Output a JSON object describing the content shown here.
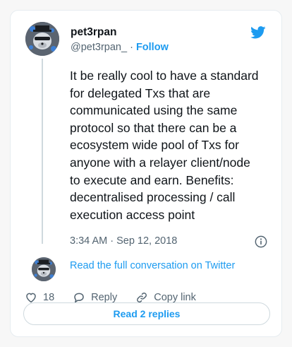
{
  "author": {
    "name": "pet3rpan",
    "handle": "@pet3rpan_",
    "separator": "·",
    "follow_label": "Follow"
  },
  "tweet": {
    "text": "It be really cool to have a standard\nfor delegated Txs that are\ncommunicated using the same\nprotocol so that there can be a\necosystem wide pool of Txs for\nanyone with a relayer client/node\nto execute and earn. Benefits:\ndecentralised processing / call\nexecution access point",
    "timestamp": "3:34 AM · Sep 12, 2018"
  },
  "conversation": {
    "link_label": "Read the full conversation on Twitter"
  },
  "actions": {
    "like_count": "18",
    "reply_label": "Reply",
    "copy_label": "Copy link"
  },
  "replies_button_label": "Read 2 replies",
  "icons": {
    "brand": "twitter-bird-icon",
    "info": "info-icon",
    "like": "heart-icon",
    "reply": "speech-bubble-icon",
    "copy": "link-icon"
  },
  "colors": {
    "accent": "#1d9bf0",
    "text": "#0f1419",
    "muted": "#536471",
    "border": "#cfd9de"
  }
}
